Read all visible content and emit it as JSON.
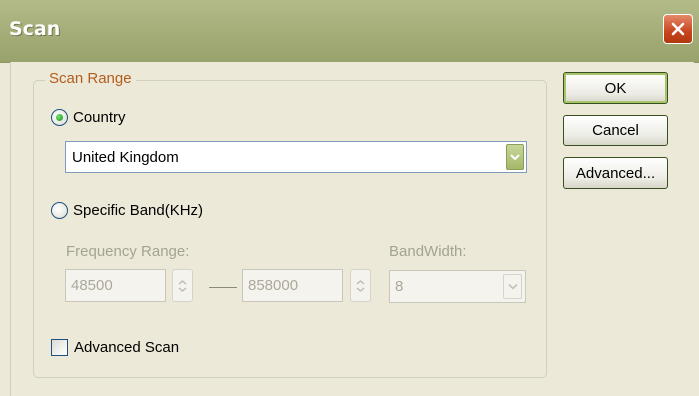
{
  "window": {
    "title": "Scan"
  },
  "group": {
    "label": "Scan Range"
  },
  "country": {
    "label": "Country",
    "selected": true,
    "value": "United Kingdom"
  },
  "band": {
    "label": "Specific Band(KHz)",
    "selected": false,
    "frequency_label": "Frequency Range:",
    "freq_min": "48500",
    "freq_max": "858000",
    "bandwidth_label": "BandWidth:",
    "bandwidth_value": "8"
  },
  "advanced_scan": {
    "label": "Advanced Scan",
    "checked": false
  },
  "buttons": {
    "ok": "OK",
    "cancel": "Cancel",
    "advanced": "Advanced..."
  },
  "colors": {
    "title_bar": "#a4ad78",
    "group_label": "#b25d1e",
    "default_button_glow": "#a7c46a",
    "disabled_text": "#a4a290"
  }
}
